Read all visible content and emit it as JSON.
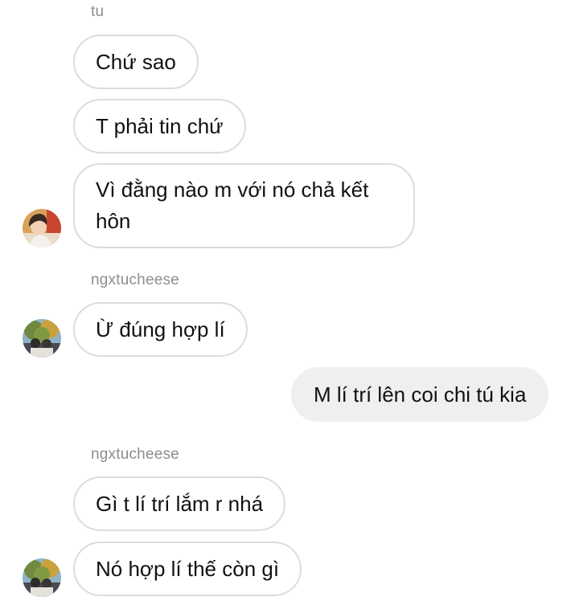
{
  "conversation": {
    "sender_top": "tu",
    "sender_group2": "ngxtucheese",
    "sender_group3": "ngxtucheese",
    "messages": {
      "m1": "Chứ sao",
      "m2": "T phải tin chứ",
      "m3_line1": "Vì đằng nào m với nó chả kết",
      "m3_line2": "hôn",
      "m4": "Ừ đúng hợp lí",
      "m5": "M lí trí lên coi chi tú kia",
      "m6": "Gì t lí trí lắm r nhá",
      "m7": "Nó hợp lí thế còn gì"
    }
  },
  "colors": {
    "incoming_border": "#dcdcdc",
    "outgoing_bg": "#efefef",
    "sender_text": "#8e8e8e"
  },
  "icons": {
    "avatar1": "avatar-photo-person",
    "avatar2": "avatar-photo-group-tree",
    "avatar3": "avatar-photo-group-tree"
  }
}
